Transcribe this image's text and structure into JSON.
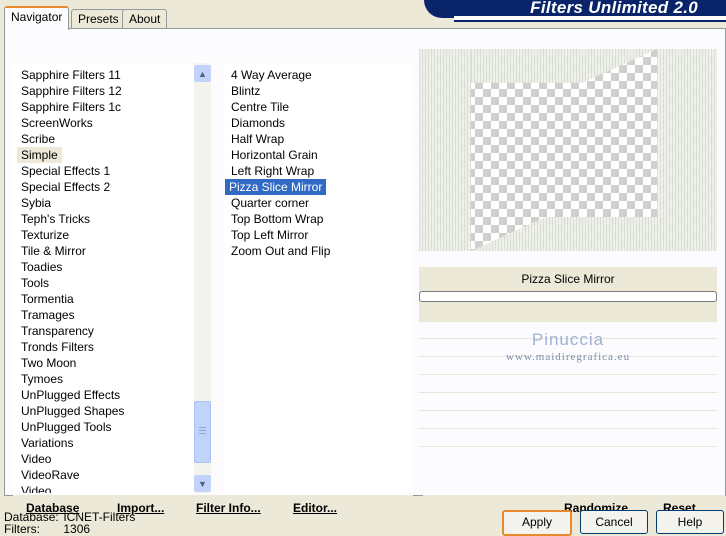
{
  "app": {
    "title": "Filters Unlimited 2.0"
  },
  "tabs": [
    {
      "label": "Navigator",
      "active": true
    },
    {
      "label": "Presets",
      "active": false
    },
    {
      "label": "About",
      "active": false
    }
  ],
  "categories": [
    "Sapphire Filters 11",
    "Sapphire Filters 12",
    "Sapphire Filters 1c",
    "ScreenWorks",
    "Scribe",
    "Simple",
    "Special Effects 1",
    "Special Effects 2",
    "Sybia",
    "Teph's Tricks",
    "Texturize",
    "Tile & Mirror",
    "Toadies",
    "Tools",
    "Tormentia",
    "Tramages",
    "Transparency",
    "Tronds Filters",
    "Two Moon",
    "Tymoes",
    "UnPlugged Effects",
    "UnPlugged Shapes",
    "UnPlugged Tools",
    "Variations",
    "Video",
    "VideoRave",
    "Video"
  ],
  "selected_category": "Simple",
  "filters": [
    "4 Way Average",
    "Blintz",
    "Centre Tile",
    "Diamonds",
    "Half Wrap",
    "Horizontal Grain",
    "Left Right Wrap",
    "Pizza Slice Mirror",
    "Quarter corner",
    "Top Bottom Wrap",
    "Top Left Mirror",
    "Zoom Out and Flip"
  ],
  "selected_filter": "Pizza Slice Mirror",
  "left_buttons": {
    "database": "Database",
    "import": "Import...",
    "filter_info": "Filter Info...",
    "editor": "Editor..."
  },
  "preview": {
    "filter_name": "Pizza Slice Mirror",
    "progress": 0
  },
  "watermark": {
    "name": "Pinuccia",
    "site": "www.maidiregrafica.eu"
  },
  "right_buttons": {
    "randomize": "Randomize",
    "reset": "Reset"
  },
  "footer": {
    "database_label": "Database:",
    "database_value": "ICNET-Filters",
    "filters_label": "Filters:",
    "filters_value": "1306"
  },
  "dialog_buttons": {
    "apply": "Apply",
    "cancel": "Cancel",
    "help": "Help"
  },
  "scroll_icons": {
    "up": "scroll-up-arrow-icon",
    "down": "scroll-down-arrow-icon"
  }
}
